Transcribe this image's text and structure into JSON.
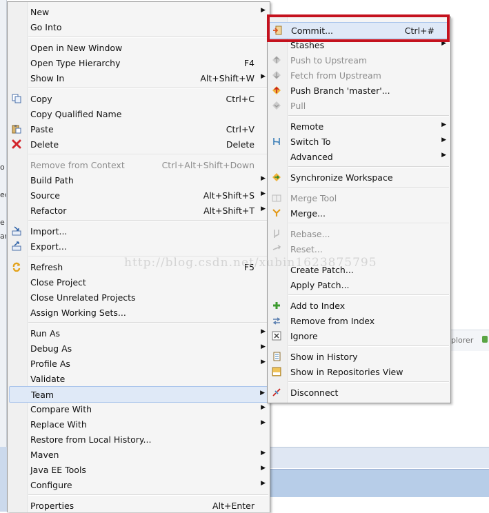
{
  "background": {
    "explorer_fragment": "plorer",
    "left_fragments": [
      "o",
      "ec",
      "e",
      "ar"
    ]
  },
  "main_menu": {
    "items": [
      {
        "label": "New",
        "shortcut": "",
        "submenu": true,
        "disabled": false
      },
      {
        "label": "Go Into",
        "shortcut": "",
        "submenu": false,
        "disabled": false
      },
      {
        "label": "Open in New Window",
        "shortcut": "",
        "submenu": false,
        "disabled": false
      },
      {
        "label": "Open Type Hierarchy",
        "shortcut": "F4",
        "submenu": false,
        "disabled": false
      },
      {
        "label": "Show In",
        "shortcut": "Alt+Shift+W",
        "submenu": true,
        "disabled": false
      },
      {
        "label": "Copy",
        "shortcut": "Ctrl+C",
        "submenu": false,
        "disabled": false
      },
      {
        "label": "Copy Qualified Name",
        "shortcut": "",
        "submenu": false,
        "disabled": false
      },
      {
        "label": "Paste",
        "shortcut": "Ctrl+V",
        "submenu": false,
        "disabled": false
      },
      {
        "label": "Delete",
        "shortcut": "Delete",
        "submenu": false,
        "disabled": false
      },
      {
        "label": "Remove from Context",
        "shortcut": "Ctrl+Alt+Shift+Down",
        "submenu": false,
        "disabled": true
      },
      {
        "label": "Build Path",
        "shortcut": "",
        "submenu": true,
        "disabled": false
      },
      {
        "label": "Source",
        "shortcut": "Alt+Shift+S",
        "submenu": true,
        "disabled": false
      },
      {
        "label": "Refactor",
        "shortcut": "Alt+Shift+T",
        "submenu": true,
        "disabled": false
      },
      {
        "label": "Import...",
        "shortcut": "",
        "submenu": false,
        "disabled": false
      },
      {
        "label": "Export...",
        "shortcut": "",
        "submenu": false,
        "disabled": false
      },
      {
        "label": "Refresh",
        "shortcut": "F5",
        "submenu": false,
        "disabled": false
      },
      {
        "label": "Close Project",
        "shortcut": "",
        "submenu": false,
        "disabled": false
      },
      {
        "label": "Close Unrelated Projects",
        "shortcut": "",
        "submenu": false,
        "disabled": false
      },
      {
        "label": "Assign Working Sets...",
        "shortcut": "",
        "submenu": false,
        "disabled": false
      },
      {
        "label": "Run As",
        "shortcut": "",
        "submenu": true,
        "disabled": false
      },
      {
        "label": "Debug As",
        "shortcut": "",
        "submenu": true,
        "disabled": false
      },
      {
        "label": "Profile As",
        "shortcut": "",
        "submenu": true,
        "disabled": false
      },
      {
        "label": "Validate",
        "shortcut": "",
        "submenu": false,
        "disabled": false
      },
      {
        "label": "Team",
        "shortcut": "",
        "submenu": true,
        "disabled": false,
        "highlighted": true
      },
      {
        "label": "Compare With",
        "shortcut": "",
        "submenu": true,
        "disabled": false
      },
      {
        "label": "Replace With",
        "shortcut": "",
        "submenu": true,
        "disabled": false
      },
      {
        "label": "Restore from Local History...",
        "shortcut": "",
        "submenu": false,
        "disabled": false
      },
      {
        "label": "Maven",
        "shortcut": "",
        "submenu": true,
        "disabled": false
      },
      {
        "label": "Java EE Tools",
        "shortcut": "",
        "submenu": true,
        "disabled": false
      },
      {
        "label": "Configure",
        "shortcut": "",
        "submenu": true,
        "disabled": false
      },
      {
        "label": "Properties",
        "shortcut": "Alt+Enter",
        "submenu": false,
        "disabled": false
      }
    ]
  },
  "team_submenu": {
    "items": [
      {
        "label": "Commit...",
        "shortcut": "Ctrl+#",
        "submenu": false,
        "disabled": false
      },
      {
        "label": "Stashes",
        "shortcut": "",
        "submenu": true,
        "disabled": false
      },
      {
        "label": "Push to Upstream",
        "shortcut": "",
        "submenu": false,
        "disabled": true
      },
      {
        "label": "Fetch from Upstream",
        "shortcut": "",
        "submenu": false,
        "disabled": true
      },
      {
        "label": "Push Branch 'master'...",
        "shortcut": "",
        "submenu": false,
        "disabled": false
      },
      {
        "label": "Pull",
        "shortcut": "",
        "submenu": false,
        "disabled": true
      },
      {
        "label": "Remote",
        "shortcut": "",
        "submenu": true,
        "disabled": false
      },
      {
        "label": "Switch To",
        "shortcut": "",
        "submenu": true,
        "disabled": false
      },
      {
        "label": "Advanced",
        "shortcut": "",
        "submenu": true,
        "disabled": false
      },
      {
        "label": "Synchronize Workspace",
        "shortcut": "",
        "submenu": false,
        "disabled": false
      },
      {
        "label": "Merge Tool",
        "shortcut": "",
        "submenu": false,
        "disabled": true
      },
      {
        "label": "Merge...",
        "shortcut": "",
        "submenu": false,
        "disabled": false
      },
      {
        "label": "Rebase...",
        "shortcut": "",
        "submenu": false,
        "disabled": true
      },
      {
        "label": "Reset...",
        "shortcut": "",
        "submenu": false,
        "disabled": true
      },
      {
        "label": "Create Patch...",
        "shortcut": "",
        "submenu": false,
        "disabled": false
      },
      {
        "label": "Apply Patch...",
        "shortcut": "",
        "submenu": false,
        "disabled": false
      },
      {
        "label": "Add to Index",
        "shortcut": "",
        "submenu": false,
        "disabled": false
      },
      {
        "label": "Remove from Index",
        "shortcut": "",
        "submenu": false,
        "disabled": false
      },
      {
        "label": "Ignore",
        "shortcut": "",
        "submenu": false,
        "disabled": false
      },
      {
        "label": "Show in History",
        "shortcut": "",
        "submenu": false,
        "disabled": false
      },
      {
        "label": "Show in Repositories View",
        "shortcut": "",
        "submenu": false,
        "disabled": false
      },
      {
        "label": "Disconnect",
        "shortcut": "",
        "submenu": false,
        "disabled": false
      }
    ]
  },
  "watermark": "http://blog.csdn.net/xubin1623875795",
  "colors": {
    "highlight_box": "#c4121e",
    "menu_bg": "#f5f5f5",
    "hover_bg": "#dfe9f7"
  },
  "submenu_arrow": "▶"
}
